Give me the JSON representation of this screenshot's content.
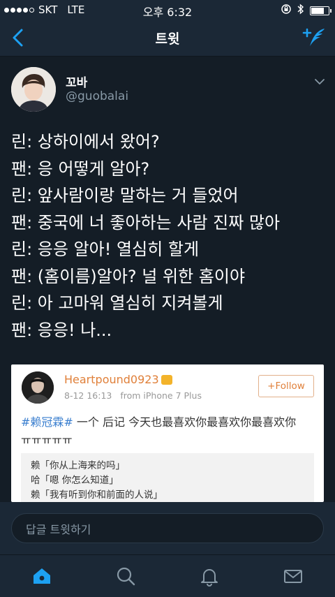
{
  "status_bar": {
    "carrier": "SKT",
    "network": "LTE",
    "time": "오후 6:32"
  },
  "nav": {
    "title": "트윗",
    "accent_color": "#1da1f2"
  },
  "tweet": {
    "display_name": "꼬바",
    "handle": "@guobalai",
    "lines": [
      "린: 상하이에서 왔어?",
      "팬: 응 어떻게 알아?",
      "린: 앞사람이랑 말하는 거 들었어",
      "팬: 중국에 너 좋아하는 사람 진짜 많아",
      "린: 응응 알아! 열심히 할게",
      "팬: (홈이름)알아? 널 위한 홈이야",
      "린: 아 고마워 열심히 지켜볼게",
      "팬: 응응! 나..."
    ]
  },
  "quoted_post": {
    "username": "Heartpound0923",
    "date": "8-12 16:13",
    "source": "from iPhone 7 Plus",
    "follow_label": "+Follow",
    "hashtag": "#赖冠霖#",
    "text": " 一个 后记 今天也最喜欢你最喜欢你最喜欢你",
    "text_line2": "ㅠㅠㅠㅠㅠ",
    "repost_lines": [
      "赖「你从上海来的吗」",
      "哈「嗯 你怎么知道」",
      "赖「我有听到你和前面的人说」"
    ]
  },
  "reply": {
    "placeholder": "답글 트윗하기"
  },
  "tab_bar": {
    "items": [
      {
        "icon": "home-icon",
        "active": true
      },
      {
        "icon": "search-icon",
        "active": false
      },
      {
        "icon": "bell-icon",
        "active": false
      },
      {
        "icon": "mail-icon",
        "active": false
      }
    ]
  }
}
